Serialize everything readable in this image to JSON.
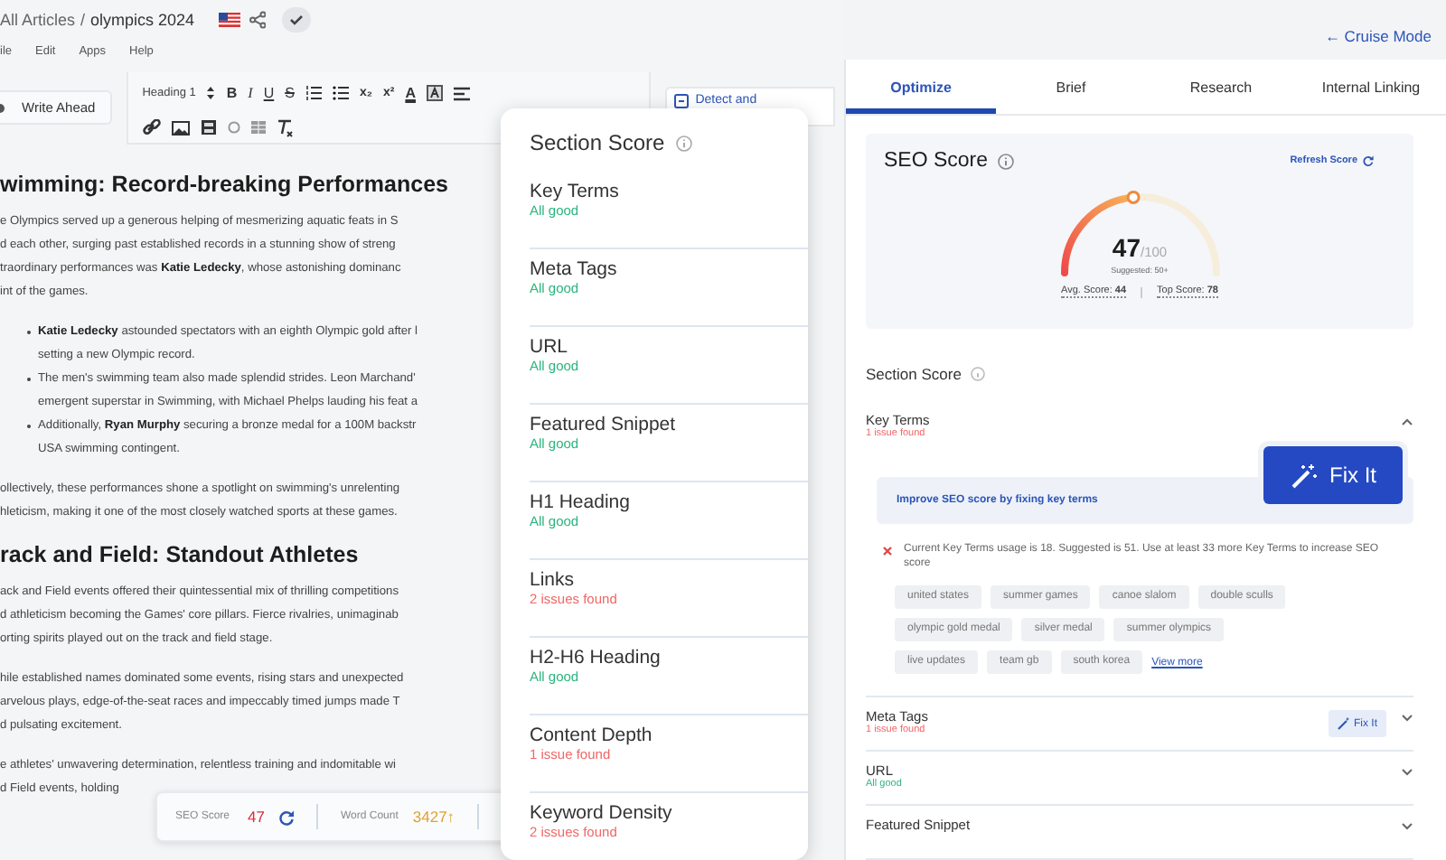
{
  "header": {
    "breadcrumb_parent": "All Articles",
    "breadcrumb_separator": "/",
    "article_title": "olympics 2024",
    "mode_link": "← Cruise Mode"
  },
  "menu": [
    "ile",
    "Edit",
    "Apps",
    "Help"
  ],
  "write_ahead_button": "Write Ahead",
  "detect_button": "Detect and",
  "toolbar": {
    "block_style": "Heading 1",
    "format_buttons": [
      "B",
      "I",
      "U",
      "S"
    ],
    "script_buttons": [
      "x₂",
      "x²"
    ],
    "color_button": "A"
  },
  "editor": [
    {
      "kind": "heading",
      "text": "wimming: Record-breaking Performances"
    },
    {
      "kind": "paragraph",
      "lines": [
        "e Olympics served up a generous helping of mesmerizing aquatic feats in S",
        "d each other, surging past established records in a stunning show of streng",
        "traordinary performances was **Katie Ledecky**, whose astonishing dominanc",
        "int of the games."
      ]
    },
    {
      "kind": "bullets",
      "items": [
        {
          "lines": [
            "**Katie Ledecky** astounded spectators with an eighth Olympic gold after l",
            "setting a new Olympic record."
          ]
        },
        {
          "lines": [
            "The men's swimming team also made splendid strides. Leon Marchand'",
            "emergent superstar in Swimming, with Michael Phelps lauding his feat a"
          ]
        },
        {
          "lines": [
            "Additionally, **Ryan Murphy** securing a bronze medal for a 100M backstr",
            "USA swimming contingent."
          ]
        }
      ]
    },
    {
      "kind": "paragraph",
      "lines": [
        "ollectively, these performances shone a spotlight on swimming's unrelenting",
        "hleticism, making it one of the most closely watched sports at these games."
      ]
    },
    {
      "kind": "heading",
      "text": "rack and Field: Standout Athletes"
    },
    {
      "kind": "paragraph",
      "lines": [
        "ack and Field events offered their quintessential mix of thrilling competitions",
        "d athleticism becoming the Games' core pillars. Fierce rivalries, unimaginab",
        "orting spirits played out on the track and field stage."
      ]
    },
    {
      "kind": "paragraph",
      "lines": [
        "hile established names dominated some events, rising stars and unexpected",
        "arvelous plays, edge-of-the-seat races and impeccably timed jumps made T",
        "d pulsating excitement."
      ]
    },
    {
      "kind": "paragraph",
      "lines": [
        "e athletes' unwavering determination, relentless training and indomitable wi",
        "d Field events, holding"
      ]
    }
  ],
  "stats_bar": {
    "seo_label": "SEO Score",
    "seo_value": "47",
    "word_label": "Word Count",
    "word_value": "3427↑"
  },
  "section_popup": {
    "title": "Section Score",
    "items": [
      {
        "title": "Key Terms",
        "status": "All good",
        "kind": "good"
      },
      {
        "title": "Meta Tags",
        "status": "All good",
        "kind": "good"
      },
      {
        "title": "URL",
        "status": "All good",
        "kind": "good"
      },
      {
        "title": "Featured Snippet",
        "status": "All good",
        "kind": "good"
      },
      {
        "title": "H1 Heading",
        "status": "All good",
        "kind": "good"
      },
      {
        "title": "Links",
        "status": "2 issues found",
        "kind": "issue"
      },
      {
        "title": "H2-H6 Heading",
        "status": "All good",
        "kind": "good"
      },
      {
        "title": "Content Depth",
        "status": "1 issue found",
        "kind": "issue"
      },
      {
        "title": "Keyword Density",
        "status": "2 issues found",
        "kind": "issue"
      }
    ]
  },
  "tabs": [
    {
      "label": "Optimize",
      "selected": true
    },
    {
      "label": "Brief",
      "selected": false
    },
    {
      "label": "Research",
      "selected": false
    },
    {
      "label": "Internal Linking",
      "selected": false
    }
  ],
  "seo_card": {
    "title": "SEO Score",
    "refresh": "Refresh Score",
    "score": "47",
    "out_of": "/100",
    "level": 0.47,
    "suggested": "Suggested: 50+",
    "avg_label": "Avg. Score:",
    "avg_value": "44",
    "top_label": "Top Score:",
    "top_value": "78"
  },
  "section_title": "Section Score",
  "sections": [
    {
      "title": "Key Terms",
      "status": "1 issue found",
      "kind": "issue",
      "expanded": true,
      "banner": "Improve SEO score by fixing key terms",
      "fix_button": "Fix It",
      "message": "Current Key Terms usage is 18. Suggested is 51. Use at least 33 more Key Terms to increase SEO score",
      "terms": [
        "united states",
        "summer games",
        "canoe slalom",
        "double sculls",
        "olympic gold medal",
        "silver medal",
        "summer olympics",
        "live updates",
        "team gb",
        "south korea"
      ],
      "more_link": "View more"
    },
    {
      "title": "Meta Tags",
      "status": "1 issue found",
      "kind": "issue",
      "expanded": false,
      "fix_button": "Fix It"
    },
    {
      "title": "URL",
      "status": "All good",
      "kind": "good",
      "expanded": false
    },
    {
      "title": "Featured Snippet",
      "expanded": false
    }
  ]
}
